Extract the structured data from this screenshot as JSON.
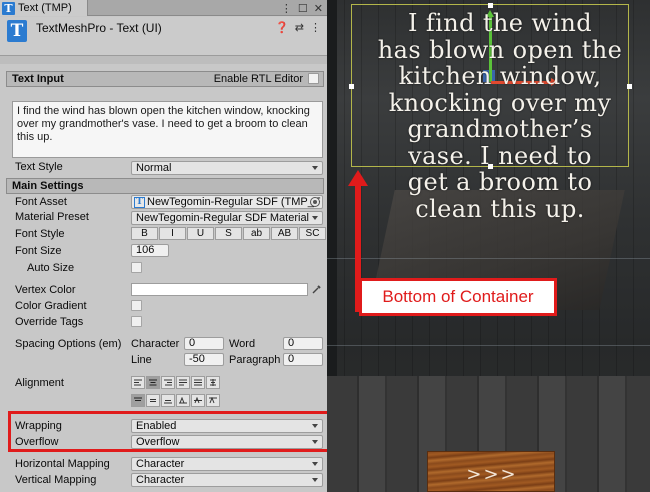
{
  "tab": {
    "title": "Text (TMP)"
  },
  "component": {
    "title": "TextMeshPro - Text (UI)"
  },
  "text_input": {
    "header": "Text Input",
    "rtl_label": "Enable RTL Editor",
    "content": "I find the wind has blown open the kitchen window, knocking over my grandmother's vase. I need to get a broom to clean this up."
  },
  "text_style": {
    "label": "Text Style",
    "value": "Normal"
  },
  "main_settings": {
    "header": "Main Settings"
  },
  "font_asset": {
    "label": "Font Asset",
    "value": "NewTegomin-Regular SDF (TMP_F"
  },
  "material_preset": {
    "label": "Material Preset",
    "value": "NewTegomin-Regular SDF Material"
  },
  "font_style": {
    "label": "Font Style",
    "buttons": [
      "B",
      "I",
      "U",
      "S",
      "ab",
      "AB",
      "SC"
    ]
  },
  "font_size": {
    "label": "Font Size",
    "value": "106"
  },
  "auto_size": {
    "label": "Auto Size"
  },
  "vertex_color": {
    "label": "Vertex Color",
    "value": "#ffffff"
  },
  "color_gradient": {
    "label": "Color Gradient"
  },
  "override_tags": {
    "label": "Override Tags"
  },
  "spacing": {
    "label": "Spacing Options (em)",
    "character_label": "Character",
    "character_value": "0",
    "word_label": "Word",
    "word_value": "0",
    "line_label": "Line",
    "line_value": "-50",
    "paragraph_label": "Paragraph",
    "paragraph_value": "0"
  },
  "alignment": {
    "label": "Alignment"
  },
  "wrapping": {
    "label": "Wrapping",
    "value": "Enabled"
  },
  "overflow": {
    "label": "Overflow",
    "value": "Overflow"
  },
  "horizontal_mapping": {
    "label": "Horizontal Mapping",
    "value": "Character"
  },
  "vertical_mapping": {
    "label": "Vertical Mapping",
    "value": "Character"
  },
  "scene": {
    "text_lines": [
      "I find the wind",
      "has blown open the",
      "kitchen window,",
      "knocking over my",
      "grandmother’s",
      "vase. I need to",
      "get a broom to",
      "clean this up."
    ],
    "callout": "Bottom of Container",
    "button_label": ">>>"
  },
  "colors": {
    "highlight": "#e01b1b",
    "tmp_blue": "#2b7bd0",
    "container_outline": "#b3b64a"
  }
}
